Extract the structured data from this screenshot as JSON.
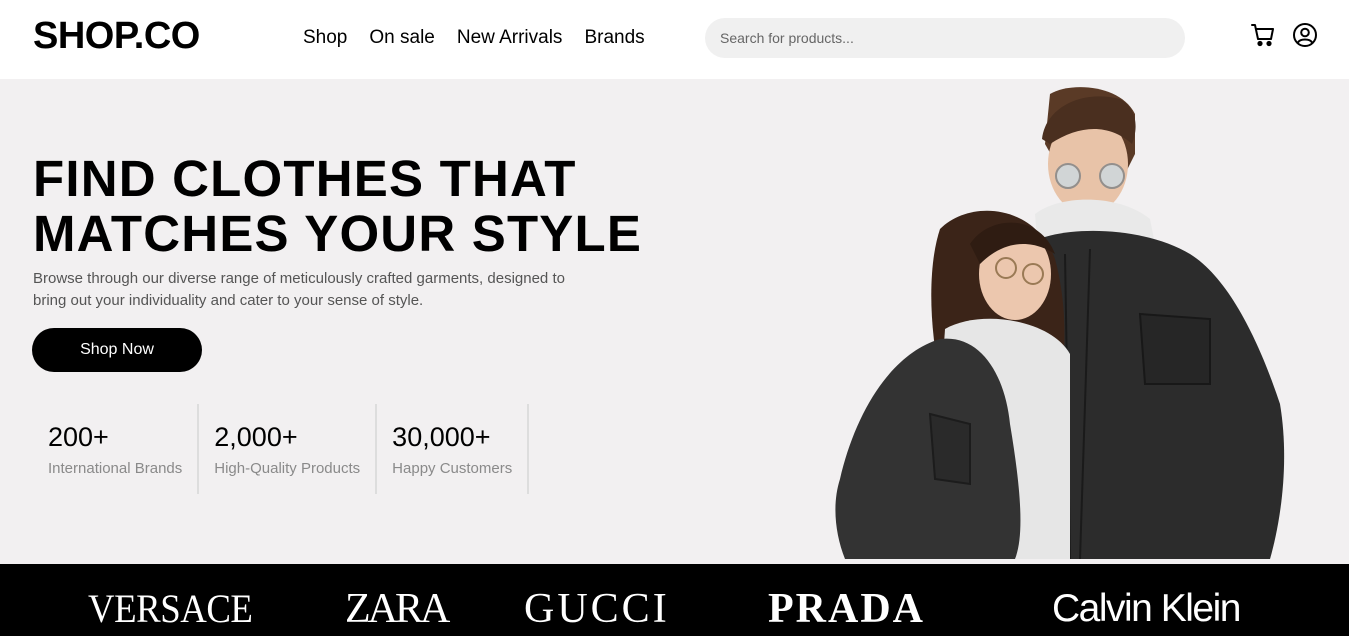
{
  "header": {
    "logo": "SHOP.CO",
    "nav": [
      "Shop",
      "On sale",
      "New Arrivals",
      "Brands"
    ],
    "search_placeholder": "Search for products...",
    "icons": [
      "cart-icon",
      "user-icon"
    ]
  },
  "hero": {
    "title_line1": "FIND CLOTHES THAT",
    "title_line2": "MATCHES YOUR STYLE",
    "description": "Browse through our diverse range of meticulously crafted garments, designed to bring out your individuality and cater to your sense of style.",
    "cta_label": "Shop Now",
    "stats": [
      {
        "value": "200+",
        "label": "International Brands"
      },
      {
        "value": "2,000+",
        "label": "High-Quality Products"
      },
      {
        "value": "30,000+",
        "label": "Happy Customers"
      }
    ]
  },
  "brands": [
    "VERSACE",
    "ZARA",
    "GUCCI",
    "PRADA",
    "Calvin Klein"
  ],
  "colors": {
    "hero_bg": "#f2f0f1",
    "brand_bar_bg": "#000000",
    "button_bg": "#000000",
    "search_bg": "#f0f0f0"
  }
}
